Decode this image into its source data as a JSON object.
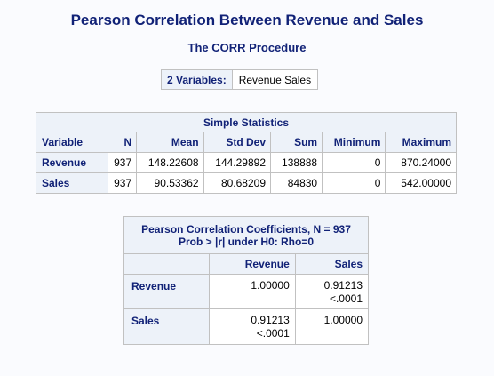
{
  "title": "Pearson Correlation Between Revenue and Sales",
  "procedure": "The CORR Procedure",
  "variables": {
    "label": "2 Variables:",
    "value": "Revenue Sales"
  },
  "simple_stats": {
    "caption": "Simple Statistics",
    "headers": [
      "Variable",
      "N",
      "Mean",
      "Std Dev",
      "Sum",
      "Minimum",
      "Maximum"
    ],
    "rows": [
      [
        "Revenue",
        "937",
        "148.22608",
        "144.29892",
        "138888",
        "0",
        "870.24000"
      ],
      [
        "Sales",
        "937",
        "90.53362",
        "80.68209",
        "84830",
        "0",
        "542.00000"
      ]
    ]
  },
  "correlation": {
    "caption_line1": "Pearson Correlation Coefficients, N = 937",
    "caption_line2": "Prob > |r| under H0: Rho=0",
    "headers": [
      "Revenue",
      "Sales"
    ],
    "rows": [
      {
        "label": "Revenue",
        "cells": [
          {
            "coef": "1.00000",
            "p": ""
          },
          {
            "coef": "0.91213",
            "p": "<.0001"
          }
        ]
      },
      {
        "label": "Sales",
        "cells": [
          {
            "coef": "0.91213",
            "p": "<.0001"
          },
          {
            "coef": "1.00000",
            "p": ""
          }
        ]
      }
    ]
  }
}
